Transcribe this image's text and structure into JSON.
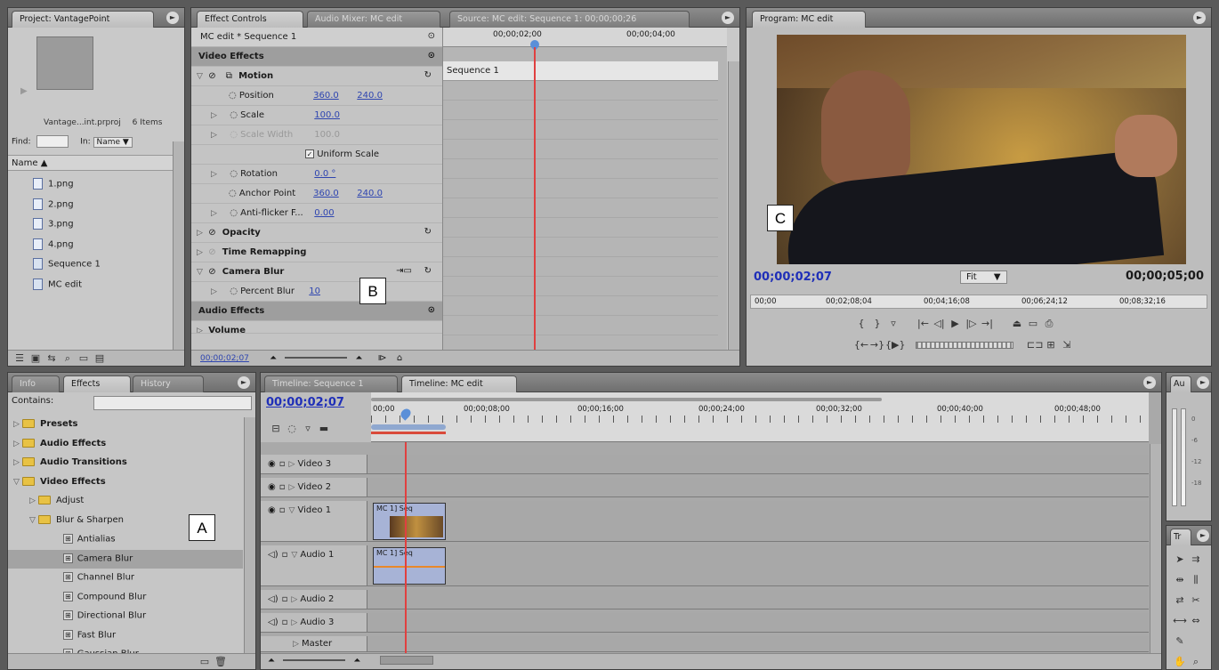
{
  "project": {
    "tab": "Project: VantagePoint",
    "file": "Vantage...int.prproj",
    "count": "6 Items",
    "find_label": "Find:",
    "in_label": "In:",
    "in_value": "Name",
    "name_header": "Name",
    "items": [
      {
        "name": "1.png",
        "icon": "image-file-icon"
      },
      {
        "name": "2.png",
        "icon": "image-file-icon"
      },
      {
        "name": "3.png",
        "icon": "image-file-icon"
      },
      {
        "name": "4.png",
        "icon": "image-file-icon"
      },
      {
        "name": "Sequence 1",
        "icon": "sequence-icon"
      },
      {
        "name": "MC edit",
        "icon": "sequence-icon"
      }
    ]
  },
  "effect_controls": {
    "tabs": [
      "Effect Controls",
      "Audio Mixer: MC edit",
      "Source: MC edit: Sequence 1: 00;00;00;26"
    ],
    "sequence": "MC edit * Sequence 1",
    "video_effects": "Video Effects",
    "motion": "Motion",
    "position_label": "Position",
    "position_x": "360.0",
    "position_y": "240.0",
    "scale_label": "Scale",
    "scale_val": "100.0",
    "scale_width_label": "Scale Width",
    "scale_width_val": "100.0",
    "uniform_scale": "Uniform Scale",
    "rotation_label": "Rotation",
    "rotation_val": "0.0 °",
    "anchor_label": "Anchor Point",
    "anchor_x": "360.0",
    "anchor_y": "240.0",
    "antiflicker_label": "Anti-flicker F...",
    "antiflicker_val": "0.00",
    "opacity": "Opacity",
    "time_remapping": "Time Remapping",
    "camera_blur": "Camera Blur",
    "percent_blur_label": "Percent Blur",
    "percent_blur_val": "10",
    "audio_effects": "Audio Effects",
    "volume": "Volume",
    "timecode": "00;00;02;07",
    "ruler": [
      "00;00;02;00",
      "00;00;04;00"
    ],
    "clip_label": "Sequence 1"
  },
  "program": {
    "tab": "Program: MC edit",
    "timecode_left": "00;00;02;07",
    "fit": "Fit",
    "timecode_right": "00;00;05;00",
    "ruler": [
      "00;00",
      "00;02;08;04",
      "00;04;16;08",
      "00;06;24;12",
      "00;08;32;16"
    ]
  },
  "effects": {
    "tabs": [
      "Info",
      "Effects",
      "History"
    ],
    "contains_label": "Contains:",
    "items": [
      {
        "label": "Presets",
        "level": 0,
        "bold": true,
        "kind": "folder"
      },
      {
        "label": "Audio Effects",
        "level": 0,
        "bold": true,
        "kind": "folder"
      },
      {
        "label": "Audio Transitions",
        "level": 0,
        "bold": true,
        "kind": "folder"
      },
      {
        "label": "Video Effects",
        "level": 0,
        "bold": true,
        "kind": "folder"
      },
      {
        "label": "Adjust",
        "level": 1,
        "bold": false,
        "kind": "folder"
      },
      {
        "label": "Blur & Sharpen",
        "level": 1,
        "bold": false,
        "kind": "folder"
      },
      {
        "label": "Antialias",
        "level": 2,
        "bold": false,
        "kind": "effect"
      },
      {
        "label": "Camera Blur",
        "level": 2,
        "bold": false,
        "kind": "effect"
      },
      {
        "label": "Channel Blur",
        "level": 2,
        "bold": false,
        "kind": "effect"
      },
      {
        "label": "Compound Blur",
        "level": 2,
        "bold": false,
        "kind": "effect"
      },
      {
        "label": "Directional Blur",
        "level": 2,
        "bold": false,
        "kind": "effect"
      },
      {
        "label": "Fast Blur",
        "level": 2,
        "bold": false,
        "kind": "effect"
      },
      {
        "label": "Gaussian Blur",
        "level": 2,
        "bold": false,
        "kind": "effect"
      }
    ]
  },
  "timeline": {
    "tabs": [
      "Timeline: Sequence 1",
      "Timeline: MC edit"
    ],
    "timecode": "00;00;02;07",
    "ruler": [
      "00;00",
      "00;00;08;00",
      "00;00;16;00",
      "00;00;24;00",
      "00;00;32;00",
      "00;00;40;00",
      "00;00;48;00"
    ],
    "tracks": [
      "Video 3",
      "Video 2",
      "Video 1",
      "Audio 1",
      "Audio 2",
      "Audio 3",
      "Master"
    ],
    "clip_v": "MC 1] Seq",
    "clip_a": "MC 1] Seq"
  },
  "audio_meters": {
    "tab": "Au",
    "marks": [
      "0",
      "-6",
      "-12",
      "-18"
    ]
  },
  "tools": {
    "tab": "Tr"
  },
  "callouts": [
    "A",
    "B",
    "C"
  ]
}
